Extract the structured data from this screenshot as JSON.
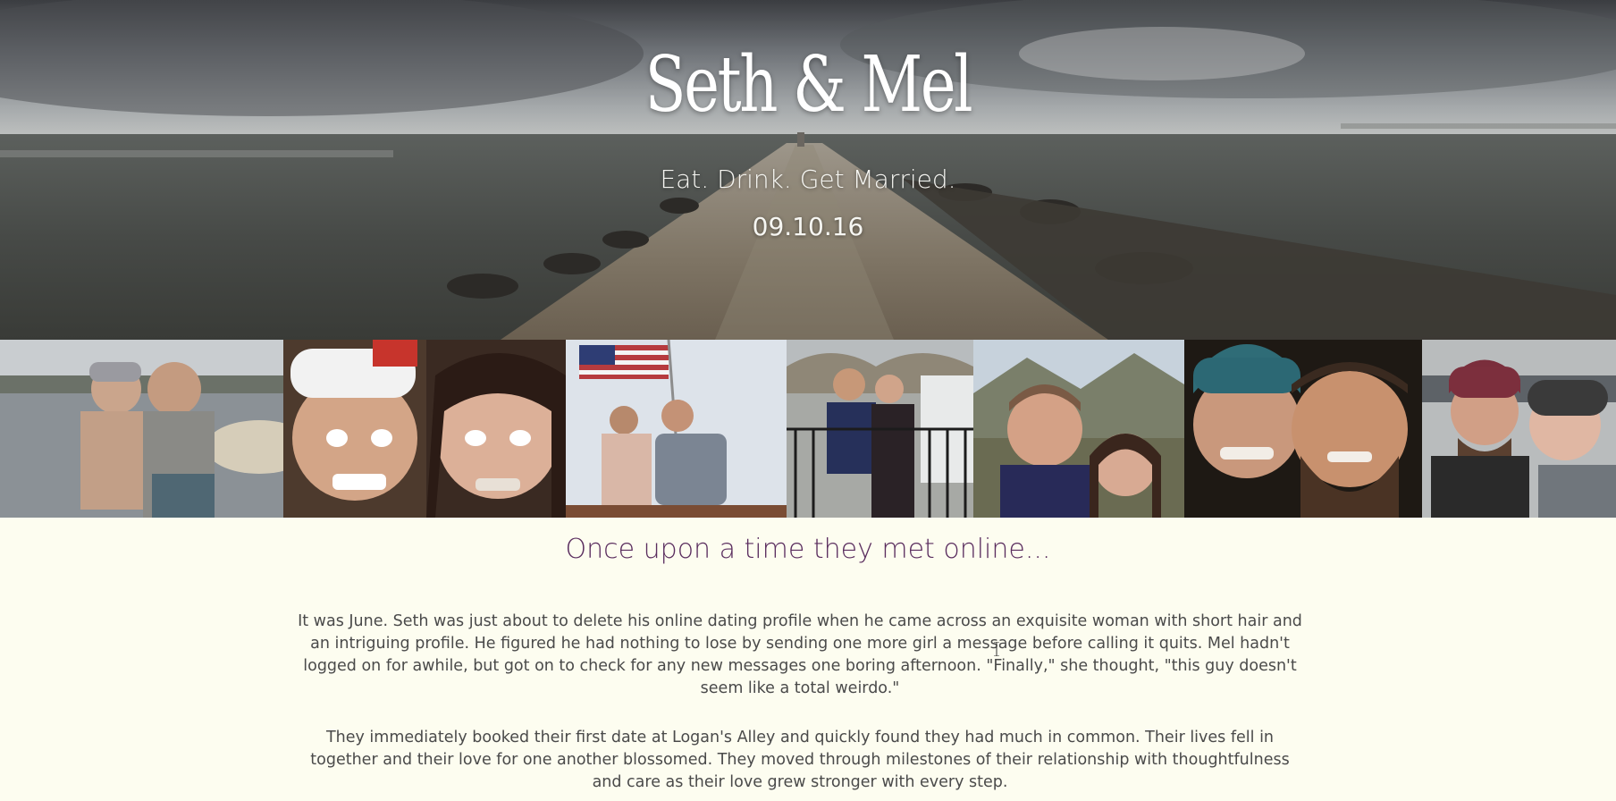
{
  "hero": {
    "title": "Seth & Mel",
    "subtitle": "Eat. Drink. Get Married.",
    "date": "09.10.16"
  },
  "photos": [
    {
      "name": "beach-couple-photo"
    },
    {
      "name": "funny-faces-selfie-photo"
    },
    {
      "name": "flag-boat-photo"
    },
    {
      "name": "bridge-river-photo"
    },
    {
      "name": "mountain-selfie-photo"
    },
    {
      "name": "night-selfie-photo"
    },
    {
      "name": "kiss-selfie-photo"
    }
  ],
  "story": {
    "heading": "Once upon a time they met online...",
    "paragraphs": [
      "It was June. Seth was just about to delete his online dating profile when he came across an exquisite woman with short hair and an intriguing profile. He figured he had nothing to lose by sending one more girl a message before calling it quits. Mel hadn't logged on for awhile, but got on to check for any new messages one boring afternoon. \"Finally,\" she thought, \"this guy doesn't seem like a total weirdo.\"",
      "They immediately booked their first date at Logan's Alley and quickly found they had much in common. Their lives fell in together and their love for one another blossomed. They moved through milestones of their relationship with thoughtfulness and care as their love grew stronger with every step."
    ]
  },
  "colors": {
    "background": "#fdfdf0",
    "heading": "#5a2d5e",
    "body_text": "#4a4a4a",
    "hero_text": "#ffffff"
  }
}
